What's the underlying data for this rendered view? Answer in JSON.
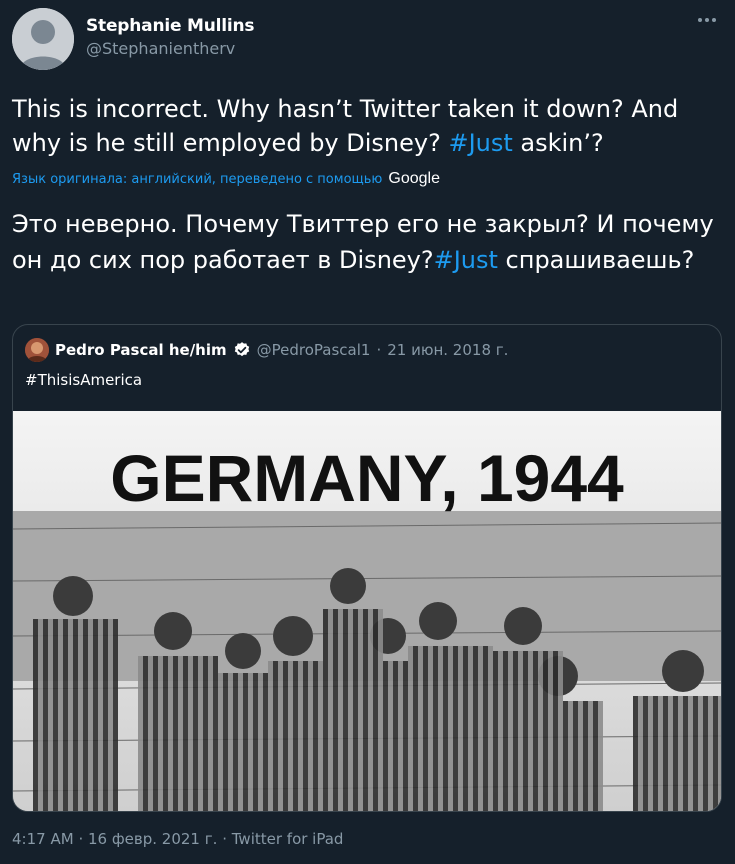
{
  "author": {
    "name": "Stephanie Mullins",
    "handle": "@Stephanientherv"
  },
  "tweet": {
    "text_before": "This is incorrect. Why hasn’t Twitter taken it down? And why is he still employed by Disney? ",
    "hashtag": "#Just",
    "text_after": " askin’?"
  },
  "translation": {
    "note": "Язык оригинала: английский, переведено с помощью",
    "provider": "Google",
    "text_before": "Это неверно. Почему Твиттер его не закрыл? И почему он до сих пор работает в Disney?",
    "hashtag": "#Just",
    "text_after": " спрашиваешь?"
  },
  "quoted": {
    "name": "Pedro Pascal he/him",
    "handle": "@PedroPascal1",
    "separator": "·",
    "date": "21 июн. 2018 г.",
    "text": "#ThisisAmerica",
    "image_caption": "GERMANY, 1944"
  },
  "footer": {
    "time": "4:17 AM",
    "separator": "·",
    "date": "16 февр. 2021 г.",
    "separator2": "·",
    "client": "Twitter for iPad"
  },
  "icons": {
    "more": "more-horizontal-icon",
    "verified": "verified-badge-icon"
  },
  "colors": {
    "background": "#15202b",
    "accent": "#1d9bf0",
    "secondary_text": "#8899a6",
    "border": "#38444d"
  }
}
